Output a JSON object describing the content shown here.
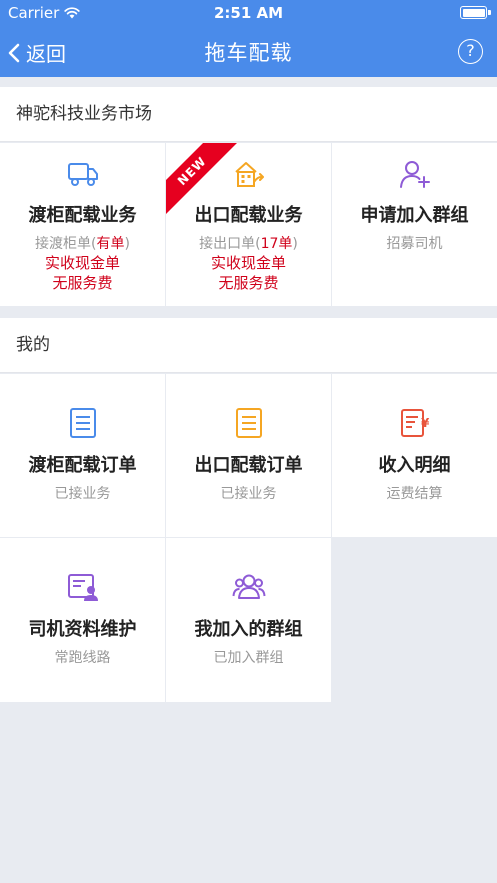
{
  "status_bar": {
    "carrier": "Carrier",
    "time": "2:51 AM"
  },
  "nav": {
    "back_label": "返回",
    "title": "拖车配载",
    "help_label": "?"
  },
  "market": {
    "header": "神驼科技业务市场",
    "cards": [
      {
        "title": "渡柜配载业务",
        "sub_prefix": "接渡柜单(",
        "sub_highlight": "有单",
        "sub_suffix": ")",
        "line1": "实收现金单",
        "line2": "无服务费",
        "icon": "truck-icon",
        "icon_color": "#4a8bea"
      },
      {
        "title": "出口配载业务",
        "sub_prefix": "接出口单(",
        "sub_highlight": "17单",
        "sub_suffix": ")",
        "line1": "实收现金单",
        "line2": "无服务费",
        "icon": "warehouse-icon",
        "icon_color": "#f5a623",
        "ribbon": "NEW"
      },
      {
        "title": "申请加入群组",
        "sub": "招募司机",
        "icon": "add-user-icon",
        "icon_color": "#8e5bd6"
      }
    ]
  },
  "mine": {
    "header": "我的",
    "cards": [
      {
        "title": "渡柜配载订单",
        "sub": "已接业务",
        "icon": "order-list-icon",
        "icon_color": "#4a8bea"
      },
      {
        "title": "出口配载订单",
        "sub": "已接业务",
        "icon": "order-list-icon",
        "icon_color": "#f5a623"
      },
      {
        "title": "收入明细",
        "sub": "运费结算",
        "icon": "income-icon",
        "icon_color": "#e8543b"
      },
      {
        "title": "司机资料维护",
        "sub": "常跑线路",
        "icon": "driver-profile-icon",
        "icon_color": "#8e5bd6"
      },
      {
        "title": "我加入的群组",
        "sub": "已加入群组",
        "icon": "group-icon",
        "icon_color": "#8e5bd6"
      }
    ]
  },
  "colors": {
    "nav_bg": "#4a8bea",
    "accent_red": "#d0021b",
    "page_bg": "#e8ebf1"
  }
}
